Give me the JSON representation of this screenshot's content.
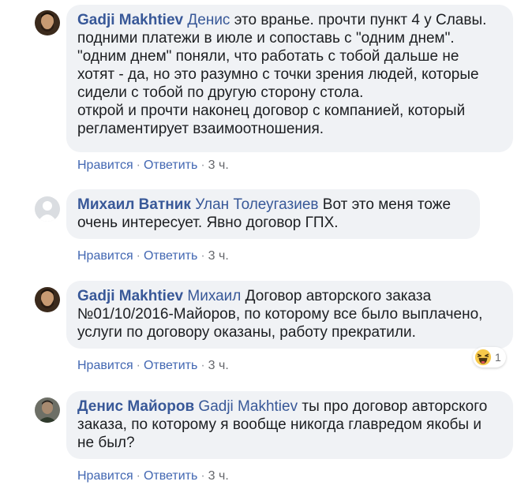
{
  "comments": [
    {
      "author": "Gadji Makhtiev",
      "mention": "Денис",
      "avatar": "avatar-photo-bearded-man",
      "lines": [
        "это вранье. прочти пункт 4 у Славы.",
        "подними платежи в июле и сопоставь с \"одним днем\".",
        "\"одним днем\" поняли, что работать с тобой дальше не",
        "хотят - да, но это разумно с точки зрения людей, которые",
        "сидели с тобой по другую сторону стола.",
        "открой и прочти наконец договор с компанией, который",
        "регламентирует взаимоотношения."
      ],
      "like_label": "Нравится",
      "reply_label": "Ответить",
      "time": "3 ч."
    },
    {
      "author": "Михаил Ватник",
      "mention": "Улан Толеугазиев",
      "avatar": "default-profile-silhouette",
      "lines": [
        "Вот это меня тоже",
        "очень интересует. Явно договор ГПХ."
      ],
      "like_label": "Нравится",
      "reply_label": "Ответить",
      "time": "3 ч."
    },
    {
      "author": "Gadji Makhtiev",
      "mention": "Михаил",
      "avatar": "avatar-photo-bearded-man",
      "lines": [
        "Договор авторского заказа",
        "№01/10/2016-Майоров, по которому все было выплачено,",
        "услуги по договору оказаны, работу прекратили."
      ],
      "reaction": {
        "icon": "haha-emoji-icon",
        "count": "1"
      },
      "like_label": "Нравится",
      "reply_label": "Ответить",
      "time": "3 ч."
    },
    {
      "author": "Денис Майоров",
      "mention": "Gadji Makhtiev",
      "avatar": "avatar-photo-man",
      "lines": [
        "ты про договор авторского",
        "заказа, по которому я вообще никогда главредом якобы и",
        "не был?"
      ],
      "like_label": "Нравится",
      "reply_label": "Ответить",
      "time": "3 ч."
    }
  ],
  "separator": "·",
  "colors": {
    "link": "#385898",
    "action": "#4267b2",
    "bubble": "#f0f2f5",
    "text": "#1c1e21",
    "meta": "#65676b"
  }
}
